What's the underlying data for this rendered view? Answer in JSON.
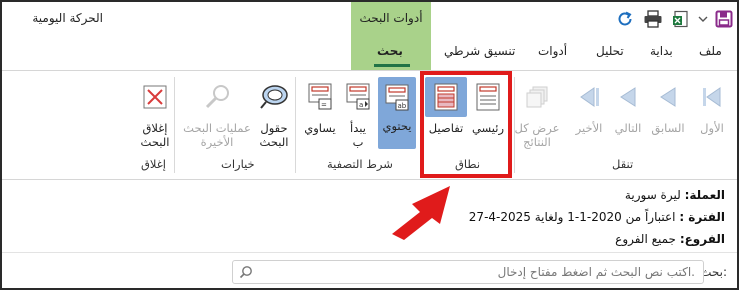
{
  "title_bar": {
    "app_title": "الحركة اليومية",
    "context_group_label": "أدوات البحث",
    "icons": [
      "save-icon",
      "chevron-down-icon",
      "excel-export-icon",
      "print-icon",
      "refresh-icon"
    ]
  },
  "tabs": [
    {
      "label": "ملف",
      "active": false
    },
    {
      "label": "بداية",
      "active": false
    },
    {
      "label": "تحليل",
      "active": false
    },
    {
      "label": "أدوات",
      "active": false
    },
    {
      "label": "تنسيق شرطي",
      "active": false
    },
    {
      "label": "بحث",
      "active": true
    }
  ],
  "ribbon": {
    "navigate": {
      "label": "تنقل",
      "buttons": {
        "first": "الأول",
        "prev": "السابق",
        "next": "التالي",
        "last": "الأخير",
        "show_all": [
          "عرض كل",
          "النتائج"
        ]
      }
    },
    "scope": {
      "label": "نطاق",
      "buttons": {
        "main": "رئيسي",
        "details": "تفاصيل"
      }
    },
    "filter": {
      "label": "شرط التصفية",
      "buttons": {
        "contains": "يحتوي",
        "starts": [
          "يبدأ",
          "ب"
        ],
        "equals": "يساوي"
      }
    },
    "options": {
      "label": "خيارات",
      "buttons": {
        "fields": [
          "حقول",
          "البحث"
        ],
        "recent": [
          "عمليات البحث",
          "الأخيرة"
        ]
      }
    },
    "close": {
      "label": "إغلاق",
      "buttons": {
        "close_search": [
          "إغلاق",
          "البحث"
        ]
      }
    }
  },
  "info": {
    "currency_label": "العملة:",
    "currency_value": "ليرة سورية",
    "period_label": "الفترة :",
    "period_value": "اعتباراً من 2020-1-1 ولغاية 2025-4-27",
    "branches_label": "الفروع:",
    "branches_value": "جميع الفروع"
  },
  "search": {
    "label": "بحث:",
    "placeholder": "اكتب نص البحث ثم اضغط مفتاح إدخال."
  },
  "colors": {
    "context_tab": "#a9d28a",
    "active_tab_underline": "#217346",
    "highlight_box": "#e01b1b",
    "selected_button": "#7fa7d9"
  }
}
